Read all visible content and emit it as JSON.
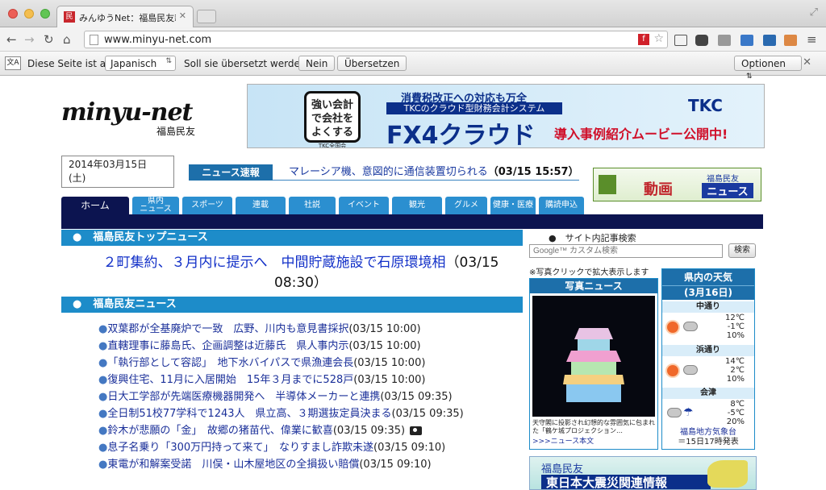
{
  "browser": {
    "tab_title": "みんゆうNet：福島民友新聞",
    "tab_favicon": "民",
    "url": "www.minyu-net.com",
    "translate": {
      "prefix": "Diese Seite ist auf",
      "language": "Japanisch",
      "question": "Soll sie übersetzt werden?",
      "no_label": "Nein",
      "translate_label": "Übersetzen",
      "options_label": "Optionen",
      "icon_text": "文A"
    }
  },
  "site": {
    "logo_main": "minyu-net",
    "logo_sub": "福島民友",
    "date_line1": "2014年03月15日",
    "date_line2": "(土)"
  },
  "ad": {
    "seal_text": "強い会計で会社をよくする",
    "seal_note": "TKC全国会",
    "line1": "消費税改正への対応も万全",
    "line2": "TKCのクラウド型財務会計システム",
    "product": "FX4クラウド",
    "cta": "導入事例紹介ムービー公開中!",
    "brand": "TKC"
  },
  "flash": {
    "label": "ニュース速報",
    "text": "マレーシア機、意図的に通信装置切られる",
    "time": "（03/15 15:57）"
  },
  "video_banner": {
    "main": "動画",
    "sub": "福島民友",
    "title": "ニュース"
  },
  "nav": {
    "tabs": [
      {
        "label": "ホーム"
      },
      {
        "label": "県内\nニュース"
      },
      {
        "label": "スポーツ"
      },
      {
        "label": "連載"
      },
      {
        "label": "社説"
      },
      {
        "label": "イベント"
      },
      {
        "label": "観光"
      },
      {
        "label": "グルメ"
      },
      {
        "label": "健康・医療"
      },
      {
        "label": "購読申込"
      }
    ]
  },
  "top_news": {
    "bar_label": "福島民友トップニュース",
    "headline": "２町集約、３月内に提示へ　中間貯蔵施設で石原環境相",
    "time": "（03/15 08:30）"
  },
  "news": {
    "bar_label": "福島民友ニュース",
    "bullet": "●",
    "items": [
      {
        "title": "双葉郡が全基廃炉で一致　広野、川内も意見書採択",
        "time": "(03/15 10:00)"
      },
      {
        "title": "直轄理事に藤島氏、企画調整は近藤氏　県人事内示",
        "time": "(03/15 10:00)"
      },
      {
        "title": "「執行部として容認」　地下水バイパスで県漁連会長",
        "time": "(03/15 10:00)"
      },
      {
        "title": "復興住宅、11月に入居開始　15年３月までに528戸",
        "time": "(03/15 10:00)"
      },
      {
        "title": "日大工学部が先端医療機器開発へ　半導体メーカーと連携",
        "time": "(03/15 09:35)"
      },
      {
        "title": "全日制51校77学科で1243人　県立高、３期選抜定員決まる",
        "time": "(03/15 09:35)"
      },
      {
        "title": "鈴木が悲願の「金」　故郷の猪苗代、偉業に歓喜",
        "time": "(03/15 09:35)"
      },
      {
        "title": "息子名乗り「300万円持って来て」　なりすまし詐欺未遂",
        "time": "(03/15 09:10)"
      },
      {
        "title": "東電が和解案受諾　川俣・山木屋地区の全損扱い賠償",
        "time": "(03/15 09:10)"
      }
    ]
  },
  "search": {
    "label": "サイト内記事検索",
    "placeholder": "Google™ カスタム検索",
    "button": "検索",
    "bullet": "●"
  },
  "photo": {
    "hint": "※写真クリックで拡大表示します",
    "title": "写真ニュース",
    "caption": "天守閣に投影され幻想的な雰囲気に包まれた「鶴ケ城プロジェクション…",
    "more": ">>>ニュース本文"
  },
  "weather": {
    "title": "県内の天気",
    "date": "(3月16日)",
    "regions": [
      {
        "name": "中通り",
        "high": "12℃",
        "low": "-1℃",
        "rain": "10%",
        "icons": [
          "sun-icon",
          "cloud-icon"
        ]
      },
      {
        "name": "浜通り",
        "high": "14℃",
        "low": "2℃",
        "rain": "10%",
        "icons": [
          "sun-icon",
          "cloud-icon"
        ]
      },
      {
        "name": "会津",
        "high": "8℃",
        "low": "-5℃",
        "rain": "20%",
        "icons": [
          "cloud-icon",
          "umbrella-icon"
        ]
      }
    ],
    "source": "福島地方気象台",
    "issued": "＝15日17時発表"
  },
  "disaster": {
    "sub": "福島民友",
    "main": "東日本大震災関連情報"
  },
  "colors": {
    "accent_blue": "#1d8cc9",
    "nav_dark": "#0c1450",
    "link_blue": "#1a2f99"
  }
}
